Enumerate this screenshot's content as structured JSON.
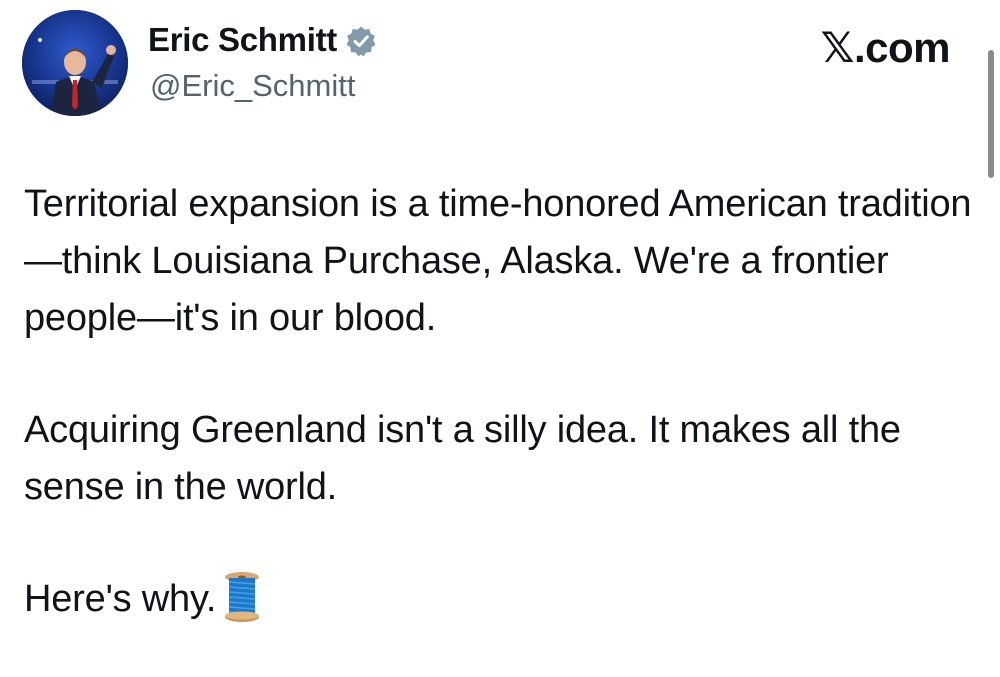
{
  "author": {
    "display_name": "Eric Schmitt",
    "handle": "@Eric_Schmitt",
    "verified_icon": "verified-badge-icon",
    "avatar_icon": "avatar-photo"
  },
  "brand": {
    "label": "𝕏.com"
  },
  "tweet": {
    "paragraphs": [
      "Territorial expansion is a time-honored American tradition—think Louisiana Purchase, Alaska. We're a frontier people—it's in our blood.",
      "Acquiring Greenland isn't a silly idea. It makes all the sense in the world.",
      "Here's why."
    ],
    "trailing_emoji": "spool-of-thread-icon"
  },
  "colors": {
    "text": "#0f1419",
    "secondary_text": "#536471",
    "verified_badge": "#829aab",
    "background": "#ffffff"
  }
}
